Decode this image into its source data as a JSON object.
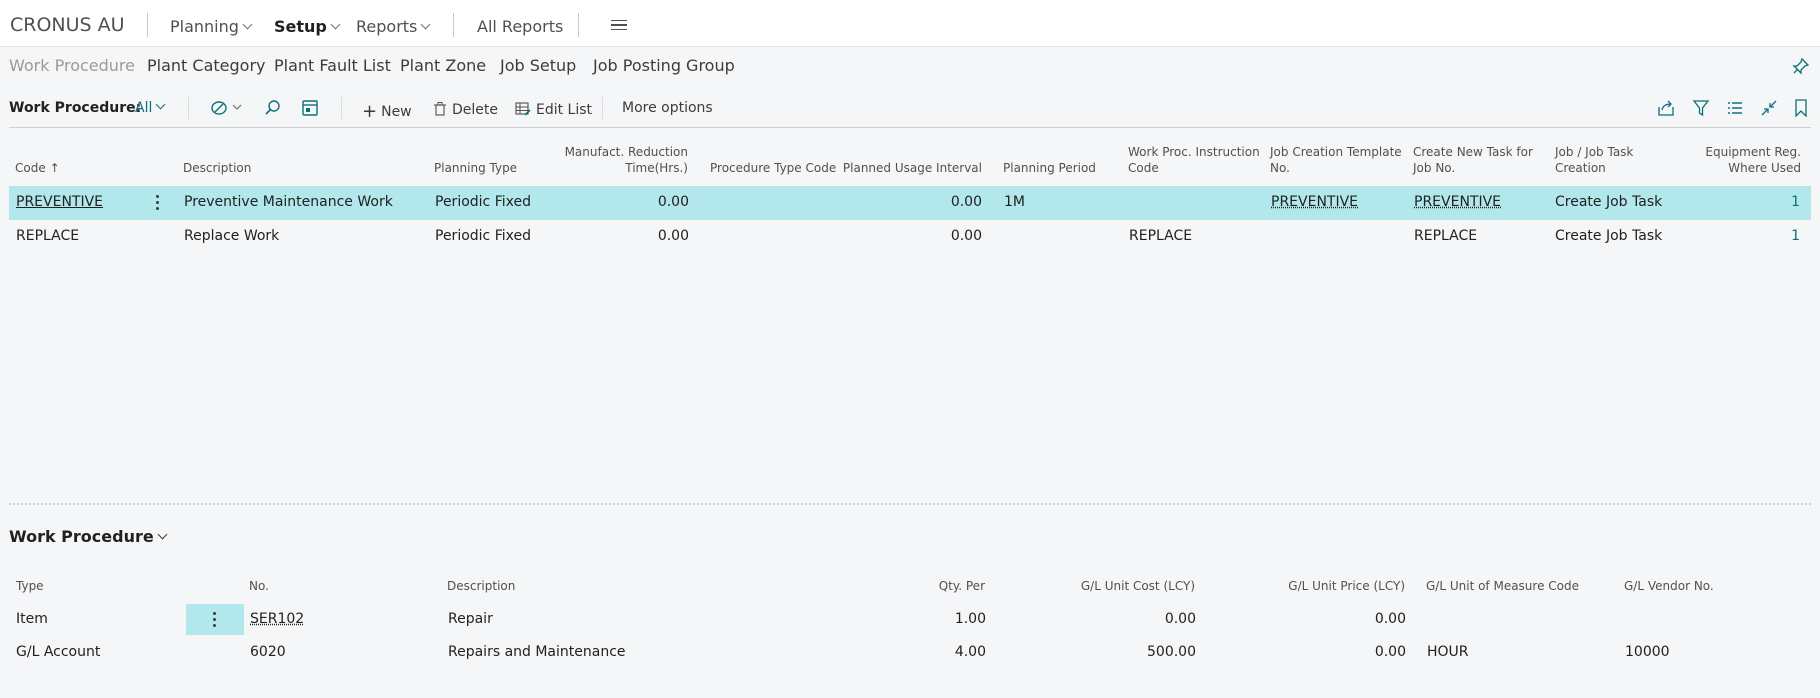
{
  "app": {
    "company": "CRONUS AU",
    "nav": [
      {
        "label": "Planning"
      },
      {
        "label": "Setup"
      },
      {
        "label": "Reports"
      }
    ],
    "all_reports": "All Reports"
  },
  "subnav": [
    "Work Procedure",
    "Plant Category",
    "Plant Fault List",
    "Plant Zone",
    "Job Setup",
    "Job Posting Group"
  ],
  "actionbar": {
    "filter_label": "Work Procedure:",
    "filter_value": "All",
    "new_label": "New",
    "delete_label": "Delete",
    "edit_list_label": "Edit List",
    "more_options_label": "More options"
  },
  "main_table": {
    "columns": [
      "Code",
      "Description",
      "Planning Type",
      "Manufact. Reduction",
      "Time(Hrs.)",
      "Procedure Type Code",
      "Planned Usage Interval",
      "Planning Period",
      "Work Proc. Instruction",
      "Code",
      "Job Creation Template",
      "No.",
      "Create New Task for",
      "Job No.",
      "Job / Job Task",
      "Creation",
      "Equipment Reg.",
      "Where Used"
    ],
    "sort_arrow": "↑",
    "rows": [
      {
        "code": "PREVENTIVE",
        "description": "Preventive Maintenance Work",
        "planning_type": "Periodic Fixed",
        "reduction": "0.00",
        "procedure_type": "",
        "usage_interval": "0.00",
        "planning_period": "1M",
        "instruction_code": "",
        "template_no": "PREVENTIVE",
        "new_task_job_no": "PREVENTIVE",
        "job_task_creation": "Create Job Task",
        "where_used": "1"
      },
      {
        "code": "REPLACE",
        "description": "Replace Work",
        "planning_type": "Periodic Fixed",
        "reduction": "0.00",
        "procedure_type": "",
        "usage_interval": "0.00",
        "planning_period": "",
        "instruction_code": "REPLACE",
        "template_no": "",
        "new_task_job_no": "REPLACE",
        "job_task_creation": "Create Job Task",
        "where_used": "1"
      }
    ]
  },
  "lines": {
    "title": "Work Procedure",
    "columns": [
      "Type",
      "No.",
      "Description",
      "Qty. Per",
      "G/L Unit Cost (LCY)",
      "G/L Unit Price (LCY)",
      "G/L Unit of Measure Code",
      "G/L Vendor No."
    ],
    "rows": [
      {
        "type": "Item",
        "no": "SER102",
        "description": "Repair",
        "qty": "1.00",
        "cost": "0.00",
        "price": "0.00",
        "uom": "",
        "vendor": ""
      },
      {
        "type": "G/L Account",
        "no": "6020",
        "description": "Repairs and Maintenance",
        "qty": "4.00",
        "cost": "500.00",
        "price": "0.00",
        "uom": "HOUR",
        "vendor": "10000"
      }
    ]
  },
  "colors": {
    "accent": "#0e6f7a",
    "selection": "#b2e8ec"
  }
}
